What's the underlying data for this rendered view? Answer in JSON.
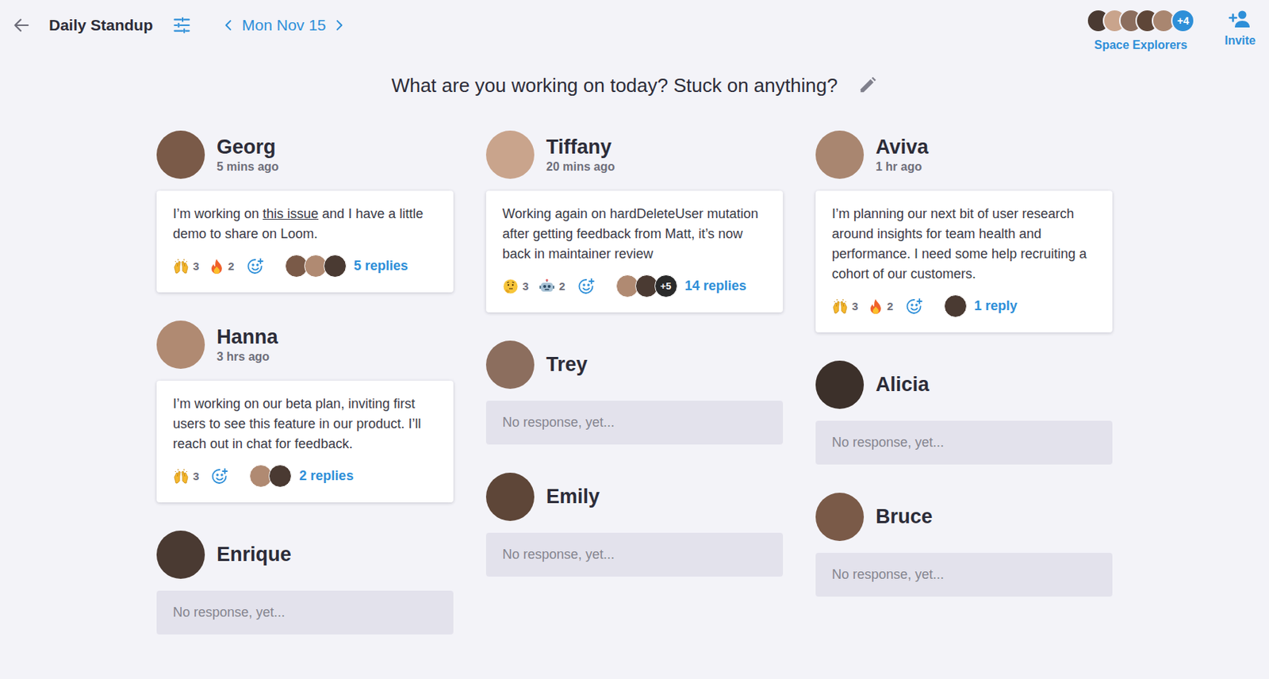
{
  "header": {
    "title": "Daily Standup",
    "date": "Mon Nov 15",
    "team": {
      "name": "Space Explorers",
      "avatar_count": 5,
      "more": "+4"
    },
    "invite": "Invite"
  },
  "prompt": "What are you working on today? Stuck on anything?",
  "columns": [
    [
      {
        "name": "Georg",
        "time": "5 mins ago",
        "responded": true,
        "message": [
          {
            "text": "I’m working on ",
            "link": false
          },
          {
            "text": "this issue",
            "link": true
          },
          {
            "text": " and I have a little demo to share on Loom.",
            "link": false
          }
        ],
        "reactions": [
          {
            "kind": "raised-hands",
            "count": "3"
          },
          {
            "kind": "fire",
            "count": "2"
          }
        ],
        "repliers": 3,
        "repliers_more": "",
        "replies": "5 replies"
      },
      {
        "name": "Hanna",
        "time": "3 hrs ago",
        "responded": true,
        "message": [
          {
            "text": "I’m working on our beta plan, inviting first users to see this feature in our product. I’ll reach out in chat for feedback.",
            "link": false
          }
        ],
        "reactions": [
          {
            "kind": "raised-hands",
            "count": "3"
          }
        ],
        "repliers": 2,
        "repliers_more": "",
        "replies": "2 replies"
      },
      {
        "name": "Enrique",
        "time": "",
        "responded": false,
        "placeholder": "No response, yet..."
      }
    ],
    [
      {
        "name": "Tiffany",
        "time": "20 mins ago",
        "responded": true,
        "message": [
          {
            "text": "Working again on hardDeleteUser mutation after getting feedback from Matt, it’s now back in maintainer review",
            "link": false
          }
        ],
        "reactions": [
          {
            "kind": "thinking",
            "count": "3"
          },
          {
            "kind": "robot",
            "count": "2"
          }
        ],
        "repliers": 2,
        "repliers_more": "+5",
        "replies": "14 replies"
      },
      {
        "name": "Trey",
        "time": "",
        "responded": false,
        "placeholder": "No response, yet..."
      },
      {
        "name": "Emily",
        "time": "",
        "responded": false,
        "placeholder": "No response, yet..."
      }
    ],
    [
      {
        "name": "Aviva",
        "time": "1 hr ago",
        "responded": true,
        "message": [
          {
            "text": "I’m planning our next bit of user research around insights for team health and performance. I need some help recruiting a cohort of our customers.",
            "link": false
          }
        ],
        "reactions": [
          {
            "kind": "raised-hands",
            "count": "3"
          },
          {
            "kind": "fire",
            "count": "2"
          }
        ],
        "repliers": 1,
        "repliers_more": "",
        "replies": "1 reply"
      },
      {
        "name": "Alicia",
        "time": "",
        "responded": false,
        "placeholder": "No response, yet..."
      },
      {
        "name": "Bruce",
        "time": "",
        "responded": false,
        "placeholder": "No response, yet..."
      }
    ]
  ]
}
